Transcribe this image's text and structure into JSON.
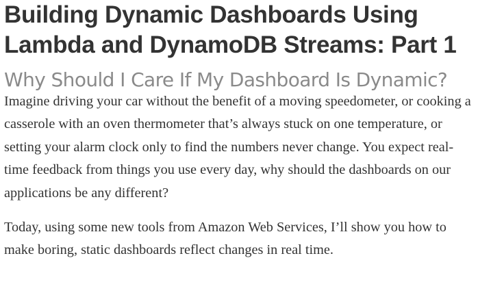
{
  "article": {
    "title": "Building Dynamic Dashboards Using\nLambda and DynamoDB Streams: Part 1",
    "section_heading": "Why Should I Care If My Dashboard Is Dynamic?",
    "paragraphs": [
      "Imagine driving your car without the benefit of a moving speedometer, or cooking a casserole with an oven thermometer that’s always stuck on one temperature, or setting your alarm clock only to find the numbers never change. You expect real-time feedback from things you use every day, why should the dashboards on our applications be any different?",
      "Today, using some new tools from Amazon Web Services, I’ll show you how to make boring, static dashboards reflect changes in real time."
    ]
  }
}
